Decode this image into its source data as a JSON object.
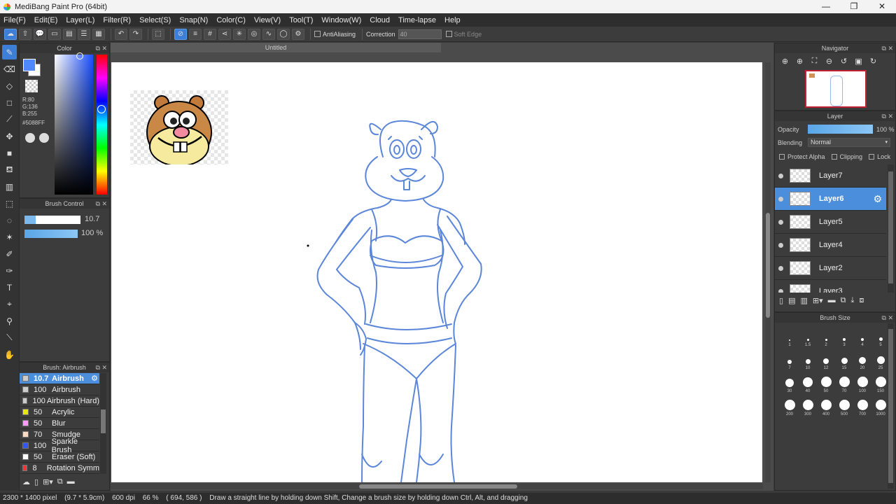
{
  "window": {
    "title": "MediBang Paint Pro (64bit)",
    "minimize": "—",
    "maximize": "❐",
    "close": "✕"
  },
  "menu": [
    "File(F)",
    "Edit(E)",
    "Layer(L)",
    "Filter(R)",
    "Select(S)",
    "Snap(N)",
    "Color(C)",
    "View(V)",
    "Tool(T)",
    "Window(W)",
    "Cloud",
    "Time-lapse",
    "Help"
  ],
  "toolbar": {
    "antialiasing_label": "AntiAliasing",
    "correction_label": "Correction",
    "correction_value": "40",
    "soft_edge_label": "Soft Edge"
  },
  "color_panel": {
    "title": "Color",
    "r": "R:80",
    "g": "G:136",
    "b": "B:255",
    "hex": "#5088FF",
    "primary_color": "#5088FF"
  },
  "brush_control": {
    "title": "Brush Control",
    "size": "10.7",
    "opacity": "100 %"
  },
  "brush_list": {
    "title": "Brush: Airbrush",
    "items": [
      {
        "size": "10.7",
        "name": "Airbrush",
        "color": "#cccccc",
        "selected": true
      },
      {
        "size": "100",
        "name": "Airbrush",
        "color": "#cccccc"
      },
      {
        "size": "100",
        "name": "Airbrush (Hard)",
        "color": "#cccccc"
      },
      {
        "size": "50",
        "name": "Acrylic",
        "color": "#e8e800"
      },
      {
        "size": "50",
        "name": "Blur",
        "color": "#ff99ff"
      },
      {
        "size": "70",
        "name": "Smudge",
        "color": "#ffd9c0"
      },
      {
        "size": "100",
        "name": "Sparkle Brush",
        "color": "#3355ff"
      },
      {
        "size": "50",
        "name": "Eraser (Soft)",
        "color": "#ffffff"
      },
      {
        "size": "8",
        "name": "Rotation Symm",
        "color": "#ff3333"
      }
    ]
  },
  "canvas": {
    "doc_tab": "Untitled"
  },
  "navigator": {
    "title": "Navigator"
  },
  "layer_panel": {
    "title": "Layer",
    "opacity_label": "Opacity",
    "opacity_value": "100 %",
    "blending_label": "Blending",
    "blending_value": "Normal",
    "protect_alpha": "Protect Alpha",
    "clipping": "Clipping",
    "lock": "Lock",
    "layers": [
      {
        "name": "Layer7",
        "selected": false
      },
      {
        "name": "Layer6",
        "selected": true
      },
      {
        "name": "Layer5",
        "selected": false
      },
      {
        "name": "Layer4",
        "selected": false
      },
      {
        "name": "Layer2",
        "selected": false
      },
      {
        "name": "Layer3",
        "selected": false
      }
    ]
  },
  "brush_size": {
    "title": "Brush Size",
    "sizes": [
      "1",
      "1.5",
      "2",
      "3",
      "4",
      "5",
      "7",
      "10",
      "12",
      "15",
      "20",
      "25",
      "30",
      "40",
      "50",
      "70",
      "100",
      "150",
      "200",
      "300",
      "400",
      "500",
      "700",
      "1000"
    ]
  },
  "status": {
    "pixels": "2300 * 1400 pixel",
    "cm": "(9.7 * 5.9cm)",
    "dpi": "600 dpi",
    "zoom": "66 %",
    "coords": "( 694, 586 )",
    "hint": "Draw a straight line by holding down Shift, Change a brush size by holding down Ctrl, Alt, and dragging"
  }
}
